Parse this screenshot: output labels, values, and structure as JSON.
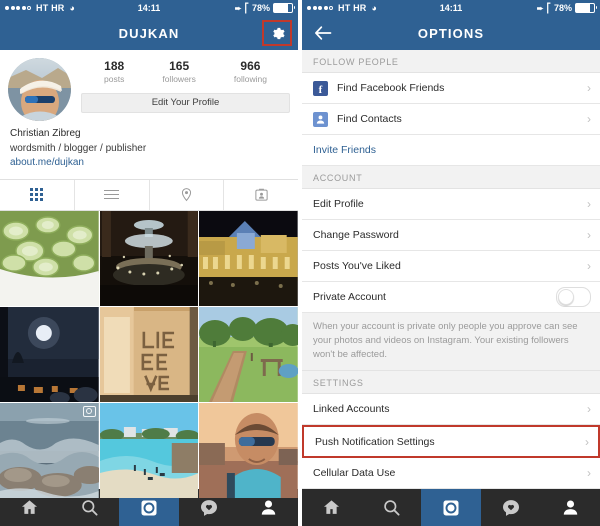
{
  "status_bar": {
    "carrier": "HT HR",
    "time": "14:11",
    "battery_percent": "78%",
    "signal_dots_filled": 4,
    "signal_dots_total": 5,
    "icons": [
      "wifi-icon",
      "location-arrow-icon",
      "bluetooth-icon",
      "battery-icon"
    ]
  },
  "colors": {
    "nav_blue": "#2f6193",
    "highlight_red": "#c0392b",
    "facebook_blue": "#3b5998",
    "contacts_blue": "#6d92d0",
    "tabbar_dark": "#2b2b2b",
    "link_blue": "#2f6193"
  },
  "profile_screen": {
    "nav": {
      "title": "DUJKAN",
      "gear_icon": "gear-icon"
    },
    "stats": [
      {
        "number": "188",
        "label": "posts"
      },
      {
        "number": "165",
        "label": "followers"
      },
      {
        "number": "966",
        "label": "following"
      }
    ],
    "edit_button": "Edit Your Profile",
    "bio": {
      "name": "Christian Zibreg",
      "description": "wordsmith / blogger / publisher",
      "link": "about.me/dujkan"
    },
    "segmented_tabs": [
      {
        "icon": "grid-icon",
        "active": true
      },
      {
        "icon": "list-icon",
        "active": false
      },
      {
        "icon": "location-pin-icon",
        "active": false
      },
      {
        "icon": "tagged-photos-icon",
        "active": false
      }
    ],
    "photos": [
      {
        "alt": "cucumber salad in white bowl",
        "video": false
      },
      {
        "alt": "illuminated fountain at night",
        "video": false
      },
      {
        "alt": "illuminated pavilion building at night",
        "video": false
      },
      {
        "alt": "full moon over night sky",
        "video": false
      },
      {
        "alt": "cardboard sign reading LIFE IS A BEACH",
        "video": false
      },
      {
        "alt": "park path with trees and playground",
        "video": false
      },
      {
        "alt": "waves crashing on rocks at dusk",
        "video": true
      },
      {
        "alt": "beach with swimmers and turquoise sea",
        "video": false
      },
      {
        "alt": "selfie of man in sunglasses at sunset",
        "video": false
      }
    ]
  },
  "options_screen": {
    "nav": {
      "title": "OPTIONS",
      "back_icon": "back-arrow-icon"
    },
    "sections": [
      {
        "header": "FOLLOW PEOPLE",
        "rows": [
          {
            "label": "Find Facebook Friends",
            "icon": "facebook-icon",
            "chevron": true,
            "style": "normal"
          },
          {
            "label": "Find Contacts",
            "icon": "contacts-icon",
            "chevron": true,
            "style": "normal"
          },
          {
            "label": "Invite Friends",
            "icon": null,
            "chevron": false,
            "style": "link"
          }
        ]
      },
      {
        "header": "ACCOUNT",
        "rows": [
          {
            "label": "Edit Profile",
            "icon": null,
            "chevron": true,
            "style": "normal"
          },
          {
            "label": "Change Password",
            "icon": null,
            "chevron": true,
            "style": "normal"
          },
          {
            "label": "Posts You've Liked",
            "icon": null,
            "chevron": true,
            "style": "normal"
          },
          {
            "label": "Private Account",
            "icon": null,
            "chevron": false,
            "style": "toggle",
            "toggle_on": false
          }
        ],
        "note": "When your account is private only people you approve can see your photos and videos on Instagram. Your existing followers won't be affected."
      },
      {
        "header": "SETTINGS",
        "rows": [
          {
            "label": "Linked Accounts",
            "icon": null,
            "chevron": true,
            "style": "normal"
          },
          {
            "label": "Push Notification Settings",
            "icon": null,
            "chevron": true,
            "style": "normal",
            "highlighted": true
          },
          {
            "label": "Cellular Data Use",
            "icon": null,
            "chevron": true,
            "style": "normal"
          }
        ]
      }
    ]
  },
  "tab_bar": {
    "items": [
      {
        "icon": "home-icon",
        "active": false
      },
      {
        "icon": "search-icon",
        "active": false
      },
      {
        "icon": "camera-icon",
        "active": true
      },
      {
        "icon": "activity-heart-icon",
        "active": false
      },
      {
        "icon": "profile-person-icon",
        "active": false
      }
    ]
  }
}
